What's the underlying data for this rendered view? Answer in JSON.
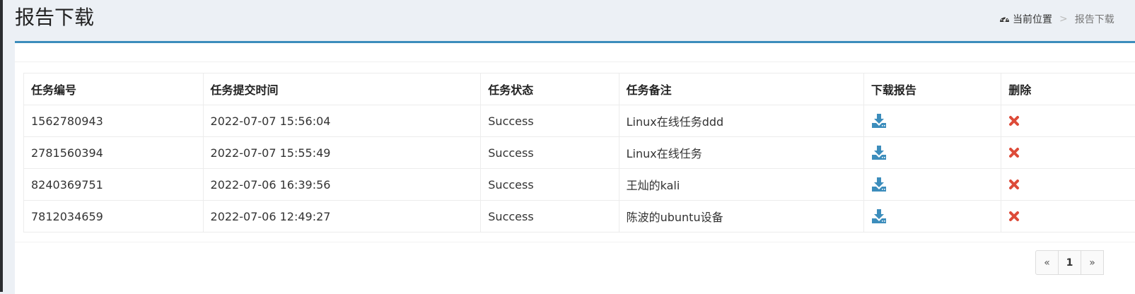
{
  "header": {
    "title": "报告下载",
    "breadcrumb": {
      "icon": "dashboard-icon",
      "root": "当前位置",
      "separator": ">",
      "current": "报告下载"
    }
  },
  "table": {
    "columns": [
      "任务编号",
      "任务提交时间",
      "任务状态",
      "任务备注",
      "下载报告",
      "删除"
    ],
    "rows": [
      {
        "id": "1562780943",
        "time": "2022-07-07 15:56:04",
        "status": "Success",
        "note": "Linux在线任务ddd"
      },
      {
        "id": "2781560394",
        "time": "2022-07-07 15:55:49",
        "status": "Success",
        "note": "Linux在线任务"
      },
      {
        "id": "8240369751",
        "time": "2022-07-06 16:39:56",
        "status": "Success",
        "note": "王灿的kali"
      },
      {
        "id": "7812034659",
        "time": "2022-07-06 12:49:27",
        "status": "Success",
        "note": "陈波的ubuntu设备"
      }
    ],
    "download_icon": "download-icon",
    "delete_icon": "delete-icon",
    "colors": {
      "download": "#3c8dbc",
      "delete": "#dd4b39"
    }
  },
  "pagination": {
    "prev": "«",
    "page": "1",
    "next": "»"
  }
}
